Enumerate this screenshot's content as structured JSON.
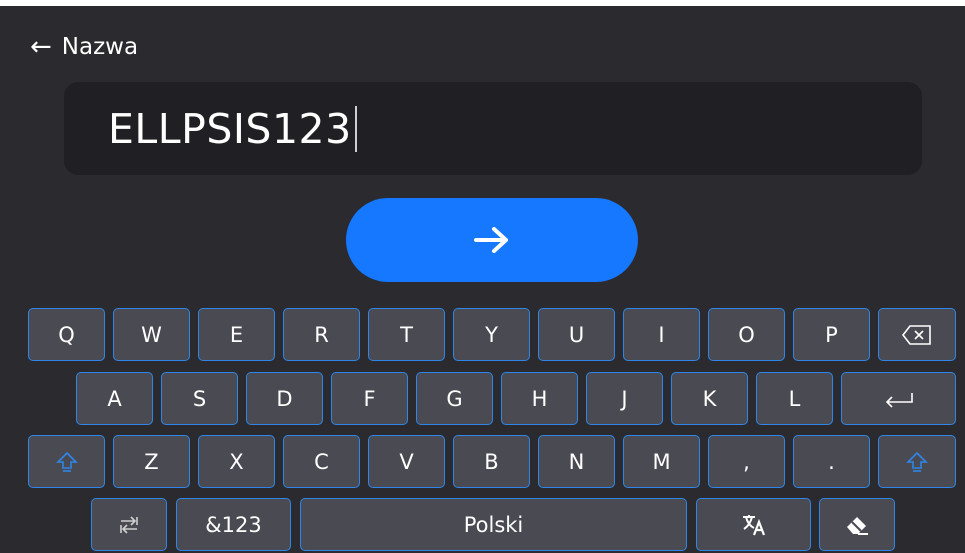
{
  "header": {
    "back_icon": "arrow-left-icon",
    "title": "Nazwa"
  },
  "input": {
    "value": "ELLPSIS123"
  },
  "submit": {
    "icon": "arrow-right-icon"
  },
  "keyboard": {
    "row1": [
      "Q",
      "W",
      "E",
      "R",
      "T",
      "Y",
      "U",
      "I",
      "O",
      "P"
    ],
    "row2": [
      "A",
      "S",
      "D",
      "F",
      "G",
      "H",
      "J",
      "K",
      "L"
    ],
    "row3": [
      "Z",
      "X",
      "C",
      "V",
      "B",
      "N",
      "M",
      ",",
      "."
    ],
    "symbols_label": "&123",
    "space_label": "Polski",
    "icons": {
      "backspace": "backspace-icon",
      "enter": "enter-icon",
      "shift": "shift-icon",
      "switch_keyboard": "switch-keyboard-icon",
      "translate": "translate-icon",
      "clear": "eraser-icon"
    }
  },
  "colors": {
    "background": "#2b2b2f",
    "field": "#202024",
    "accent": "#1677ff",
    "key": "#4a4a52",
    "key_border": "#2f86e8"
  }
}
